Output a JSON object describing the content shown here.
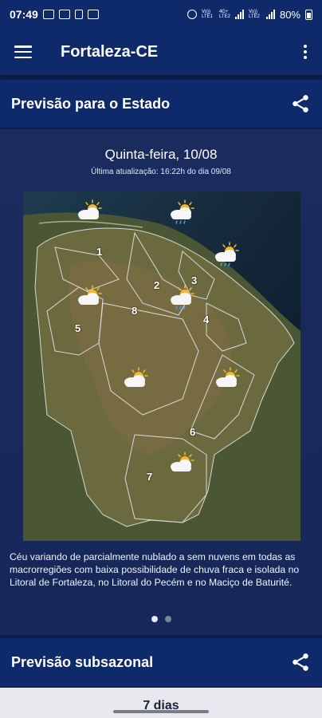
{
  "status_bar": {
    "time": "07:49",
    "battery": "80%",
    "network_label_1": "Vo)) LTE1",
    "network_label_2": "4G+ LTE2",
    "network_label_3": "Vo)) LTE2"
  },
  "app_bar": {
    "title": "Fortaleza-CE",
    "menu_icon": "hamburger-menu-icon",
    "overflow_icon": "more-vert-icon"
  },
  "state_forecast": {
    "header": "Previsão para o Estado",
    "share_icon": "share-icon",
    "date": "Quinta-feira, 10/08",
    "updated": "Última atualização: 16:22h do dia 09/08",
    "description": "Céu variando de parcialmente nublado a sem nuvens em todas as macrorregiões com baixa possibilidade de chuva fraca e isolada no Litoral de Fortaleza, no Litoral do Pecém e no Maciço de Baturité.",
    "regions": [
      "1",
      "2",
      "3",
      "4",
      "5",
      "6",
      "7",
      "8"
    ],
    "weather_icons": [
      "partly-cloudy-icon",
      "partly-cloudy-rain-icon",
      "partly-cloudy-rain-icon",
      "partly-cloudy-icon",
      "partly-cloudy-rain-icon",
      "partly-cloudy-icon",
      "partly-cloudy-icon",
      "partly-cloudy-icon"
    ],
    "carousel_pages": 2,
    "carousel_active_index": 0
  },
  "subseasonal": {
    "header": "Previsão subsazonal",
    "share_icon": "share-icon",
    "peek_text": "7 dias"
  },
  "colors": {
    "app_bar": "#0e2a6b",
    "background": "#0d1f4f",
    "card": "#1a2c5e",
    "sun": "#f5b82e",
    "cloud": "#f4f4f4",
    "rain": "#3fa9f5"
  }
}
